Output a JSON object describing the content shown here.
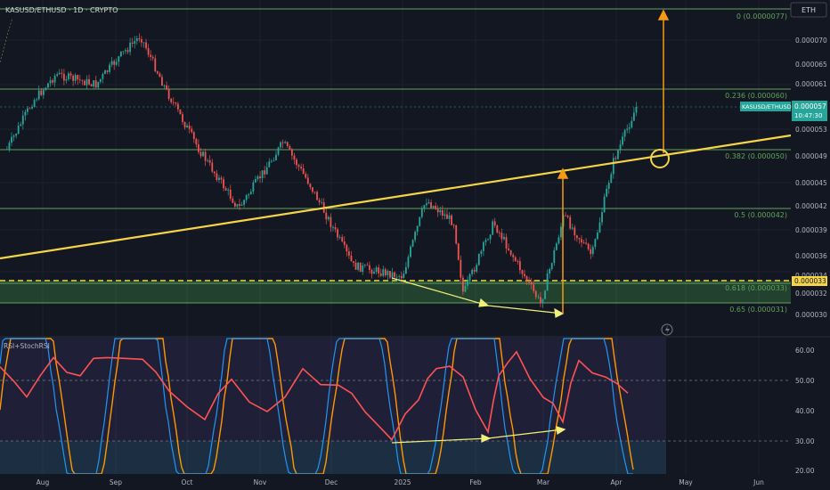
{
  "header": {
    "symbol_title": "KASUSD/ETHUSD · 1D · CRYPTO",
    "currency_badge": "ETH"
  },
  "colors": {
    "background": "#131722",
    "up": "#26a69a",
    "down": "#ef5350",
    "fib_line": "#5fa35a",
    "trendline": "#f5d547",
    "arrow": "#f39c12",
    "divergence": "#f0f07a",
    "rsi": "#ff5252",
    "stoch_k": "#2196f3",
    "stoch_d": "#ff9800",
    "current_price_tag": "#26a69a",
    "highlight_tag": "#f5d547"
  },
  "fib_levels": [
    {
      "label": "0 (0.0000077)",
      "value": 7.7e-06
    },
    {
      "label": "0.236 (0.000060)",
      "value": 6e-06
    },
    {
      "label": "0.382 (0.000050)",
      "value": 5e-06
    },
    {
      "label": "0.5 (0.000042)",
      "value": 4.2e-06
    },
    {
      "label": "0.618 (0.000033)",
      "value": 3.3e-06
    },
    {
      "label": "0.65 (0.000031)",
      "value": 3.1e-06
    }
  ],
  "price_axis": {
    "ticks": [
      "0.000070",
      "0.000065",
      "0.000061",
      "0.000057",
      "0.000053",
      "0.000049",
      "0.000045",
      "0.000042",
      "0.000039",
      "0.000036",
      "0.000034",
      "0.000032",
      "0.000030"
    ],
    "current_price_label": "KASUSD/ETHUSD",
    "current_price": "0.000057",
    "countdown": "10:47:30",
    "highlight_price": "0.000033"
  },
  "time_axis": {
    "ticks": [
      "Aug",
      "Sep",
      "Oct",
      "Nov",
      "Dec",
      "2025",
      "Feb",
      "Mar",
      "Apr",
      "May",
      "Jun"
    ]
  },
  "rsi_panel": {
    "title": "RSI+StochRSI",
    "ticks": [
      "60.00",
      "50.00",
      "40.00",
      "30.00",
      "20.00"
    ]
  },
  "chart_data": {
    "type": "candlestick",
    "title": "KASUSD/ETHUSD · 1D · CRYPTO",
    "x_range": [
      "2024-07-22",
      "2025-06-25"
    ],
    "y_range_approx": [
      3e-06,
      7.7e-06
    ],
    "price_path_approx": [
      {
        "date": "2024-07-25",
        "close": 5e-06
      },
      {
        "date": "2024-08-05",
        "close": 5.8e-06
      },
      {
        "date": "2024-08-15",
        "close": 6.3e-06
      },
      {
        "date": "2024-09-01",
        "close": 6.1e-06
      },
      {
        "date": "2024-09-10",
        "close": 6.6e-06
      },
      {
        "date": "2024-09-20",
        "close": 7.1e-06
      },
      {
        "date": "2024-10-01",
        "close": 6e-06
      },
      {
        "date": "2024-10-15",
        "close": 5e-06
      },
      {
        "date": "2024-11-01",
        "close": 4.2e-06
      },
      {
        "date": "2024-11-20",
        "close": 5.1e-06
      },
      {
        "date": "2024-12-01",
        "close": 4.5e-06
      },
      {
        "date": "2024-12-20",
        "close": 3.5e-06
      },
      {
        "date": "2025-01-10",
        "close": 3.4e-06
      },
      {
        "date": "2025-01-20",
        "close": 4.3e-06
      },
      {
        "date": "2025-02-01",
        "close": 4e-06
      },
      {
        "date": "2025-02-05",
        "close": 3.2e-06
      },
      {
        "date": "2025-02-18",
        "close": 4e-06
      },
      {
        "date": "2025-03-10",
        "close": 3.1e-06
      },
      {
        "date": "2025-03-20",
        "close": 4.1e-06
      },
      {
        "date": "2025-04-01",
        "close": 3.6e-06
      },
      {
        "date": "2025-04-10",
        "close": 4.8e-06
      },
      {
        "date": "2025-04-20",
        "close": 5.7e-06
      }
    ],
    "rsi_range": [
      20,
      65
    ]
  }
}
